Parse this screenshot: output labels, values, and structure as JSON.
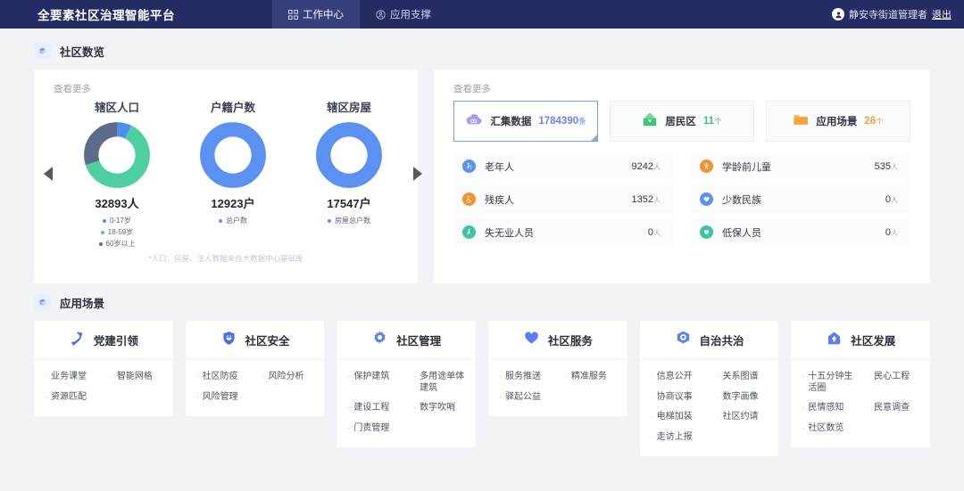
{
  "header": {
    "brand": "全要素社区治理智能平台",
    "tabs": [
      {
        "label": "工作中心",
        "icon": "grid-icon",
        "active": true
      },
      {
        "label": "应用支撑",
        "icon": "user-circle-icon",
        "active": false
      }
    ],
    "user": "静安寺街道管理者",
    "logout": "退出"
  },
  "overview": {
    "section_title": "社区数览",
    "section_icon": "cube-icon",
    "view_more": "查看更多",
    "footnote": "*人口、房屋、法人数据来自大数据中心基础库",
    "arrow_prev": "prev-arrow",
    "arrow_next": "next-arrow"
  },
  "chart_data": [
    {
      "type": "pie",
      "title": "辖区人口",
      "total_label": "32893人",
      "categories": [
        "0-17岁",
        "18-59岁",
        "60岁以上"
      ],
      "values": [
        7,
        63,
        30
      ],
      "colors": [
        "#4a8ef0",
        "#4ecf9f",
        "#5c6b8a"
      ],
      "legend": "bottom"
    },
    {
      "type": "pie",
      "title": "户籍户数",
      "total_label": "12923户",
      "categories": [
        "总户数"
      ],
      "values": [
        100
      ],
      "colors": [
        "#5b92f2"
      ],
      "legend": "bottom"
    },
    {
      "type": "pie",
      "title": "辖区房屋",
      "total_label": "17547户",
      "categories": [
        "房屋总户数"
      ],
      "values": [
        100
      ],
      "colors": [
        "#5b92f2"
      ],
      "legend": "bottom"
    }
  ],
  "datapanel": {
    "view_more": "查看更多",
    "chips": [
      {
        "label": "汇集数据",
        "value": "1784390",
        "unit": "条",
        "icon": "cloud-icon",
        "icon_color": "#9b8ef0",
        "value_color": "#6b7ff0",
        "selected": true
      },
      {
        "label": "居民区",
        "value": "11",
        "unit": "个",
        "icon": "house-icon",
        "icon_color": "#3fc27a",
        "value_color": "#3fc27a",
        "selected": false
      },
      {
        "label": "应用场景",
        "value": "26",
        "unit": "个",
        "icon": "folder-icon",
        "icon_color": "#f2a03d",
        "value_color": "#f2a03d",
        "selected": false
      }
    ],
    "stats_left": [
      {
        "label": "老年人",
        "value": "9242",
        "unit": "人",
        "icon": "elderly-icon",
        "color": "#5b92f2"
      },
      {
        "label": "残疾人",
        "value": "1352",
        "unit": "人",
        "icon": "wheelchair-icon",
        "color": "#f2952f"
      },
      {
        "label": "失无业人员",
        "value": "0",
        "unit": "人",
        "icon": "jobless-icon",
        "color": "#3fc2a0"
      }
    ],
    "stats_right": [
      {
        "label": "学龄前儿童",
        "value": "535",
        "unit": "人",
        "icon": "child-icon",
        "color": "#f2952f"
      },
      {
        "label": "少数民族",
        "value": "0",
        "unit": "人",
        "icon": "ethnic-icon",
        "color": "#5b92f2"
      },
      {
        "label": "低保人员",
        "value": "0",
        "unit": "人",
        "icon": "welfare-icon",
        "color": "#3fc2a0"
      }
    ]
  },
  "scenarios": {
    "section_title": "应用场景",
    "section_icon": "cube-icon",
    "cards": [
      {
        "name": "党建引领",
        "icon": "hammer-sickle-icon",
        "items": [
          "业务课堂",
          "智能网格",
          "资源匹配"
        ]
      },
      {
        "name": "社区安全",
        "icon": "shield-icon",
        "items": [
          "社区防疫",
          "风险分析",
          "风险管理"
        ]
      },
      {
        "name": "社区管理",
        "icon": "gear-icon",
        "items": [
          "保护建筑",
          "多用途单体建筑",
          "建设工程",
          "数字吹哨",
          "门责管理"
        ]
      },
      {
        "name": "社区服务",
        "icon": "heart-icon",
        "items": [
          "服务推送",
          "精准服务",
          "驿起公益"
        ]
      },
      {
        "name": "自治共治",
        "icon": "target-icon",
        "items": [
          "信息公开",
          "关系图谱",
          "协商议事",
          "数字画像",
          "电梯加装",
          "社区约请",
          "走访上报"
        ]
      },
      {
        "name": "社区发展",
        "icon": "home-up-icon",
        "items": [
          "十五分钟生活圈",
          "民心工程",
          "民情感知",
          "民意调查",
          "社区数览"
        ]
      }
    ]
  }
}
